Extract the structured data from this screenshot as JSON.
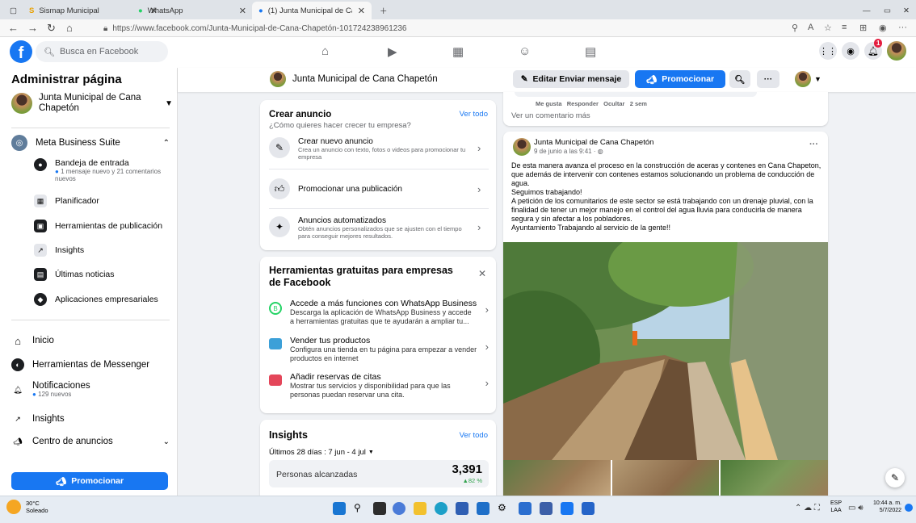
{
  "browser": {
    "tabs": [
      {
        "label": "Sismap Municipal"
      },
      {
        "label": "WhatsApp"
      },
      {
        "label": "(1) Junta Municipal de Cana Cha"
      }
    ],
    "url": "https://www.facebook.com/Junta-Municipal-de-Cana-Chapetón-101724238961236"
  },
  "fb": {
    "search_placeholder": "Busca en Facebook",
    "notif_badge": "1"
  },
  "sidebar": {
    "title": "Administrar página",
    "page_name": "Junta Municipal de Cana Chapetón",
    "meta_suite": "Meta Business Suite",
    "sub_items": [
      {
        "label": "Bandeja de entrada",
        "note": "1 mensaje nuevo y 21 comentarios nuevos"
      },
      {
        "label": "Planificador"
      },
      {
        "label": "Herramientas de publicación"
      },
      {
        "label": "Insights"
      },
      {
        "label": "Últimas noticias"
      },
      {
        "label": "Aplicaciones empresariales"
      }
    ],
    "items": [
      {
        "label": "Inicio"
      },
      {
        "label": "Herramientas de Messenger"
      },
      {
        "label": "Notificaciones",
        "note": "129 nuevos"
      },
      {
        "label": "Insights"
      },
      {
        "label": "Centro de anuncios"
      }
    ],
    "promote": "Promocionar"
  },
  "pagebar": {
    "name": "Junta Municipal de Cana Chapetón",
    "edit_label": "Editar Enviar mensaje",
    "promote_label": "Promocionar",
    "more": "···"
  },
  "ads_card": {
    "title": "Crear anuncio",
    "subtitle": "¿Cómo quieres hacer crecer tu empresa?",
    "see_all": "Ver todo",
    "rows": [
      {
        "title": "Crear nuevo anuncio",
        "desc": "Crea un anuncio con texto, fotos o videos para promocionar tu empresa"
      },
      {
        "title": "Promocionar una publicación",
        "desc": ""
      },
      {
        "title": "Anuncios automatizados",
        "desc": "Obtén anuncios personalizados que se ajusten con el tiempo para conseguir mejores resultados."
      }
    ]
  },
  "tools_card": {
    "title": "Herramientas gratuitas para empresas de Facebook",
    "rows": [
      {
        "title": "Accede a más funciones con WhatsApp Business",
        "desc": "Descarga la aplicación de WhatsApp Business y accede a herramientas gratuitas que te ayudarán a ampliar tu..."
      },
      {
        "title": "Vender tus productos",
        "desc": "Configura una tienda en tu página para empezar a vender productos en internet"
      },
      {
        "title": "Añadir reservas de citas",
        "desc": "Mostrar tus servicios y disponibilidad para que las personas puedan reservar una cita."
      }
    ]
  },
  "insights_card": {
    "title": "Insights",
    "see_all": "Ver todo",
    "range": "Últimos 28 días : 7 jun - 4 jul",
    "metric_label": "Personas alcanzadas",
    "metric_value": "3,391",
    "metric_change": "82 %"
  },
  "comment_strip": {
    "actions": "Me gusta   Responder   Ocultar   2 sem",
    "more": "Ver un comentario más"
  },
  "post": {
    "author": "Junta Municipal de Cana Chapetón",
    "time": "9 de junio a las 9:41 · ",
    "more": "···",
    "text_lines": [
      "De esta manera avanza el proceso en la construcción de aceras y contenes en Cana Chapeton,",
      "que además de intervenir con contenes estamos solucionando un problema de conducción de",
      "agua.",
      "Seguimos trabajando!",
      "A petición de los comunitarios de este sector se está trabajando con un drenaje pluvial, con la",
      "finalidad de tener un mejor manejo en el control del agua lluvia para conducirla de manera",
      "segura y sin afectar a los pobladores.",
      "Ayuntamiento Trabajando al servicio de la gente!!"
    ]
  },
  "taskbar": {
    "weather_temp": "30°C",
    "weather_desc": "Soleado",
    "lang_top": "ESP",
    "lang_bottom": "LAA",
    "time": "10:44 a. m.",
    "date": "5/7/2022"
  }
}
